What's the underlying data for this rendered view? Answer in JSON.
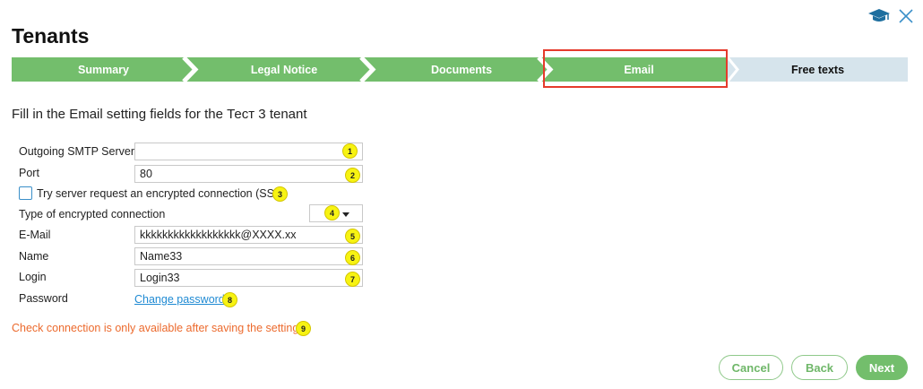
{
  "page": {
    "title": "Tenants"
  },
  "wizard": {
    "steps": [
      {
        "label": "Summary"
      },
      {
        "label": "Legal Notice"
      },
      {
        "label": "Documents"
      },
      {
        "label": "Email"
      },
      {
        "label": "Free texts"
      }
    ],
    "current": "Email"
  },
  "intro": "Fill in the Email setting fields for the Тест 3 tenant",
  "form": {
    "smtp_label": "Outgoing SMTP Server",
    "smtp_value": "",
    "port_label": "Port",
    "port_value": "80",
    "ssl_label": "Try server request an encrypted connection (SSL)",
    "encryption_label": "Type of encrypted connection",
    "email_label": "E-Mail",
    "email_value": "kkkkkkkkkkkkkkkkkk@XXXX.xx",
    "name_label": "Name",
    "name_value": "Name33",
    "login_label": "Login",
    "login_value": "Login33",
    "password_label": "Password",
    "change_password": "Change password"
  },
  "warning": "Check connection is only available after saving the settings!",
  "badges": [
    "1",
    "2",
    "3",
    "4",
    "5",
    "6",
    "7",
    "8",
    "9"
  ],
  "buttons": {
    "cancel": "Cancel",
    "back": "Back",
    "next": "Next"
  },
  "icons": {
    "help": "graduation-cap-icon",
    "close": "close-icon"
  },
  "colors": {
    "accent": "#73be6c",
    "highlight": "#e53b2c",
    "warning": "#ec6a2d",
    "link": "#1f8ad3"
  }
}
